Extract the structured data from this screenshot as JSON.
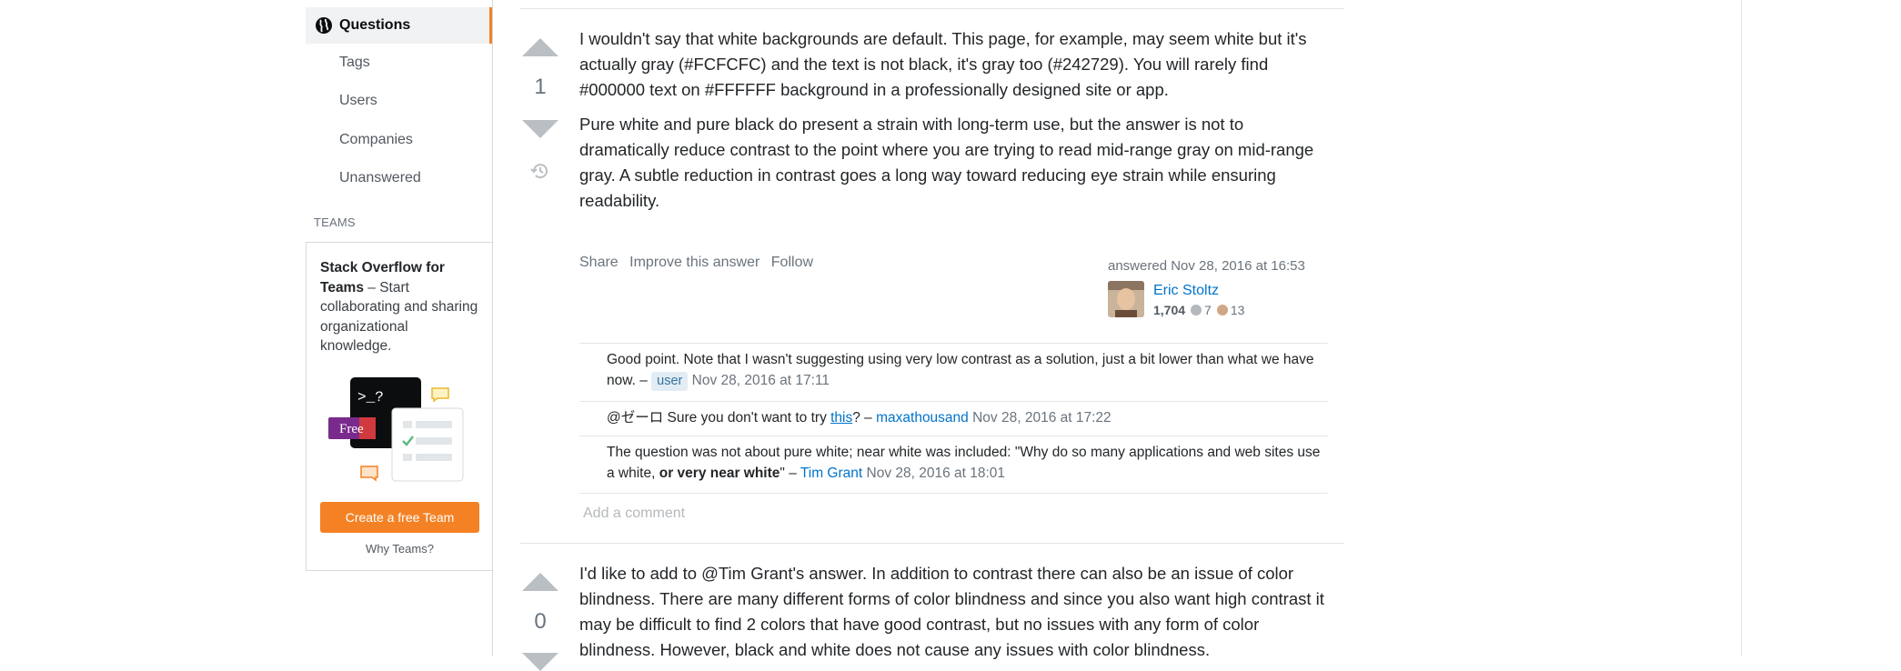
{
  "nav": {
    "active": "Questions",
    "items": [
      "Tags",
      "Users",
      "Companies",
      "Unanswered"
    ],
    "section_label": "TEAMS"
  },
  "teams": {
    "title": "Stack Overflow for Teams",
    "desc": " – Start collaborating and sharing organizational knowledge.",
    "free_badge": "Free",
    "terminal_text": ">_?",
    "create_button": "Create a free Team",
    "why_link": "Why Teams?"
  },
  "answer1": {
    "score": "1",
    "paragraphs": [
      "I wouldn't say that white backgrounds are default. This page, for example, may seem white but it's actually gray (#FCFCFC) and the text is not black, it's gray too (#242729). You will rarely find #000000 text on #FFFFFF background in a professionally designed site or app.",
      "Pure white and pure black do present a strain with long-term use, but the answer is not to dramatically reduce contrast to the point where you are trying to read mid-range gray on mid-range gray. A subtle reduction in contrast goes a long way toward reducing eye strain while ensuring readability."
    ],
    "actions": {
      "share": "Share",
      "improve": "Improve this answer",
      "follow": "Follow"
    },
    "answered": "answered Nov 28, 2016 at 16:53",
    "user": {
      "name": "Eric Stoltz",
      "rep": "1,704",
      "silver": "7",
      "bronze": "13"
    },
    "colors": {
      "silver": "#b4b8bc",
      "bronze": "#d1a684"
    }
  },
  "comments": [
    {
      "text": "Good point. Note that I wasn't suggesting using very low contrast as a solution, just a bit lower than what we have now. – ",
      "user": "user",
      "date": "Nov 28, 2016 at 17:11"
    },
    {
      "pre": "@ゼーロ Sure you don't want to try ",
      "link": "this",
      "post": "? – ",
      "user": "maxathousand",
      "date": "Nov 28, 2016 at 17:22"
    },
    {
      "pre": "The question was not about pure white; near white was included: \"Why do so many applications and web sites use a white, ",
      "bold": "or very near white",
      "post": "\" – ",
      "user": "Tim Grant",
      "date": "Nov 28, 2016 at 18:01"
    }
  ],
  "add_comment": "Add a comment",
  "answer2": {
    "score": "0",
    "text": "I'd like to add to @Tim Grant's answer. In addition to contrast there can also be an issue of color blindness. There are many different forms of color blindness and since you also want high contrast it may be difficult to find 2 colors that have good contrast, but no issues with any form of color blindness. However, black and white does not cause any issues with color blindness."
  }
}
